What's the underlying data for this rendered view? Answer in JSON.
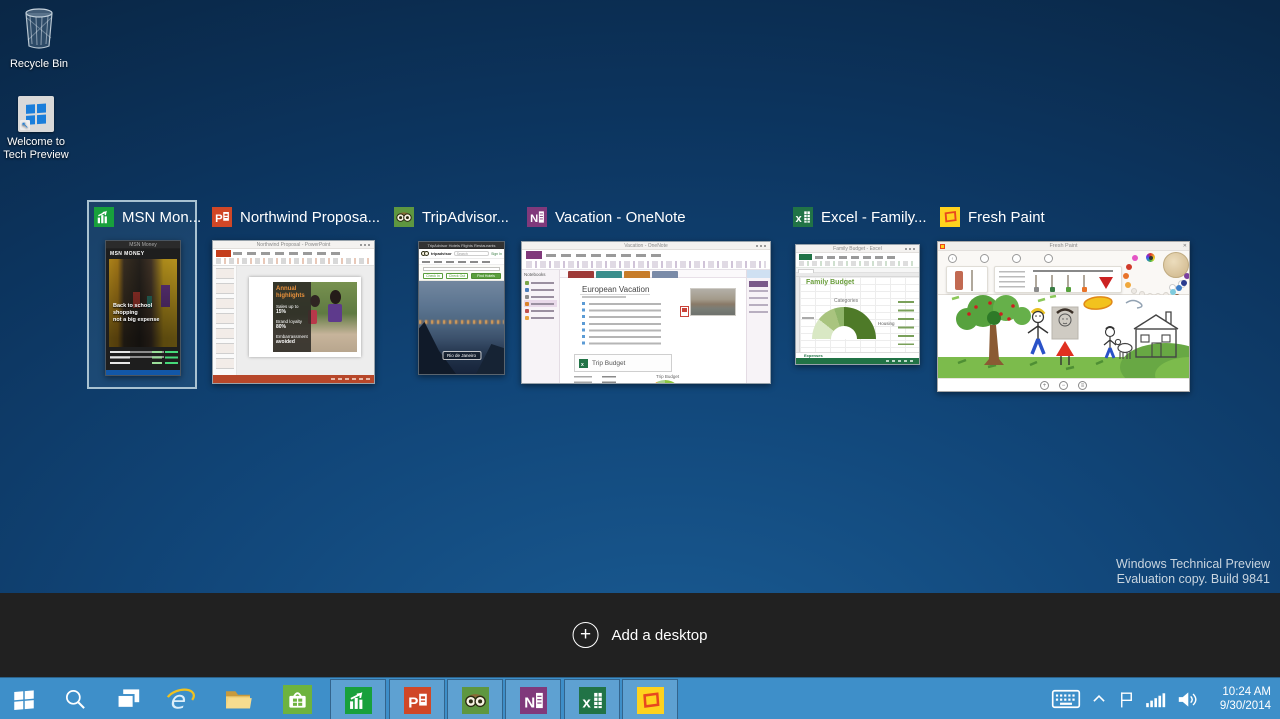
{
  "desktop": {
    "recycle_bin_label": "Recycle Bin",
    "welcome_label_line1": "Welcome to",
    "welcome_label_line2": "Tech Preview",
    "watermark_line1": "Windows Technical Preview",
    "watermark_line2": "Evaluation copy. Build 9841"
  },
  "task_view": {
    "add_desktop_label": "Add a desktop",
    "windows": [
      {
        "title": "MSN Mon...",
        "app": "msn-money",
        "selected": true
      },
      {
        "title": "Northwind Proposa...",
        "app": "powerpoint",
        "selected": false
      },
      {
        "title": "TripAdvisor...",
        "app": "tripadvisor",
        "selected": false
      },
      {
        "title": "Vacation - OneNote",
        "app": "onenote",
        "selected": false
      },
      {
        "title": "Excel - Family...",
        "app": "excel",
        "selected": false
      },
      {
        "title": "Fresh Paint",
        "app": "fresh-paint",
        "selected": false
      }
    ]
  },
  "thumbs": {
    "msn": {
      "window_title": "MSN Money",
      "header": "MSN MONEY",
      "headline_line1": "Back to school shopping",
      "headline_line2": "not a big expense"
    },
    "ppt": {
      "window_title": "Northwind Proposal - PowerPoint",
      "slide_heading": "Annual highlights",
      "stat1_label": "Sales up to",
      "stat1_value": "15%",
      "stat2_label": "Brand loyalty",
      "stat2_value": "80%",
      "stat3_label": "Embarrassment",
      "stat3_value": "avoided"
    },
    "trip": {
      "window_title": "TripAdvisor Hotels Flights Restaurants",
      "brand": "tripadvisor",
      "search_placeholder": "Search",
      "signin": "Sign In",
      "btn_checkin": "Check In",
      "btn_checkout": "Check Out",
      "btn_find": "Find Hotels",
      "photo_caption": "Rio de Janeiro"
    },
    "onenote": {
      "window_title": "Vacation - OneNote",
      "notebooks_label": "Notebooks",
      "page_title": "European Vacation",
      "budget_box_label": "Trip Budget",
      "chart_title": "Trip Budget"
    },
    "excel": {
      "window_title": "Family Budget - Excel",
      "sheet_title": "Family Budget",
      "chart_title": "Categories",
      "label_housing": "Housing",
      "sheet_tab": "Expenses"
    },
    "paint": {
      "window_title": "Fresh Paint"
    }
  },
  "taskbar": {
    "clock_time": "10:24 AM",
    "clock_date": "9/30/2014"
  },
  "colors": {
    "taskbar_blue": "#3E8FC9",
    "msn_green": "#18A03C",
    "powerpoint_orange": "#D04727",
    "tripadvisor_green": "#5E9740",
    "onenote_purple": "#80397B",
    "excel_green": "#217346",
    "freshpaint_yellow": "#FFD21E",
    "freshpaint_frame": "#E8471F",
    "store_green": "#6DB33F",
    "desktop_dark": "#0A2038"
  }
}
